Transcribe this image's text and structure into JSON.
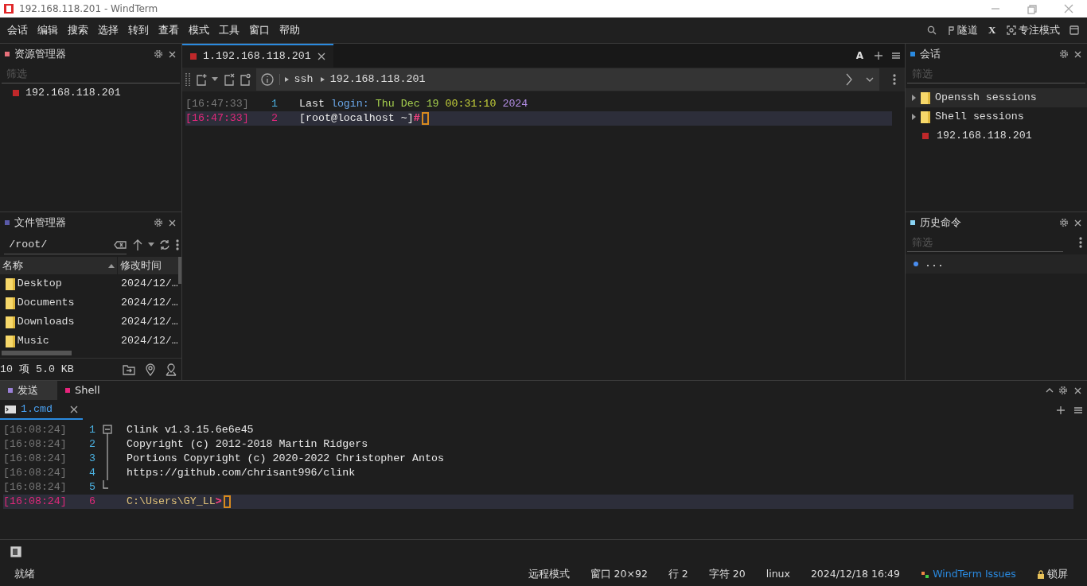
{
  "window": {
    "title": "192.168.118.201 - WindTerm"
  },
  "menu": [
    "会话",
    "编辑",
    "搜索",
    "选择",
    "转到",
    "查看",
    "模式",
    "工具",
    "窗口",
    "帮助"
  ],
  "toolbar": {
    "tunnel": "隧道",
    "x_label": "X",
    "focus": "专注模式"
  },
  "explorer": {
    "title": "资源管理器",
    "placeholder": "筛选",
    "items": [
      {
        "label": "192.168.118.201"
      }
    ]
  },
  "file_manager": {
    "title": "文件管理器",
    "path": "/root/",
    "columns": [
      "名称",
      "修改时间"
    ],
    "rows": [
      {
        "name": "Desktop",
        "modified": "2024/12/…"
      },
      {
        "name": "Documents",
        "modified": "2024/12/…"
      },
      {
        "name": "Downloads",
        "modified": "2024/12/…"
      },
      {
        "name": "Music",
        "modified": "2024/12/…"
      }
    ],
    "summary": "10 项 5.0 KB"
  },
  "terminal": {
    "tabs": [
      {
        "label": "1.192.168.118.201",
        "selected": true
      }
    ],
    "font_button": "A",
    "breadcrumb": [
      "ssh",
      "192.168.118.201"
    ],
    "lines": [
      {
        "time": "[16:47:33]",
        "number": "1",
        "selected": false,
        "segments": [
          {
            "text": "Last",
            "color": "#e8e8e8"
          },
          {
            "text": "login:",
            "color": "#6aa6e8"
          },
          {
            "text": "Thu Dec",
            "color": "#a6d04e"
          },
          {
            "text": "19",
            "color": "#a6d04e"
          },
          {
            "text": "00:31:10",
            "color": "#c6d23a"
          },
          {
            "text": "2024",
            "color": "#b48ee6"
          }
        ]
      },
      {
        "time": "[16:47:33]",
        "number": "2",
        "selected": true,
        "segments": [
          {
            "text": "[root@localhost ~]",
            "color": "#e8e8e8"
          },
          {
            "text": "#",
            "color": "#e8407c",
            "tight": true
          }
        ]
      }
    ]
  },
  "sessions": {
    "title": "会话",
    "placeholder": "筛选",
    "tree": [
      {
        "label": "Openssh sessions",
        "kind": "folder",
        "selected": true
      },
      {
        "label": "Shell sessions",
        "kind": "folder",
        "selected": false
      },
      {
        "label": "192.168.118.201",
        "kind": "session",
        "selected": false
      }
    ]
  },
  "history": {
    "title": "历史命令",
    "placeholder": "筛选",
    "items": [
      "..."
    ]
  },
  "bottom": {
    "tabs": [
      {
        "label": "发送",
        "selected": true,
        "color": "#9a80d8"
      },
      {
        "label": "Shell",
        "selected": false,
        "color": "#e8247c"
      }
    ],
    "sub_tabs": [
      {
        "label": "1.cmd",
        "selected": true
      }
    ],
    "lines": [
      {
        "time": "[16:08:24]",
        "number": "1",
        "selected": false,
        "segments": [
          {
            "text": "Clink v1.3.15.6e6e45",
            "color": "#e8e8e8"
          }
        ]
      },
      {
        "time": "[16:08:24]",
        "number": "2",
        "selected": false,
        "segments": [
          {
            "text": "Copyright (c) 2012-2018 Martin Ridgers",
            "color": "#e8e8e8"
          }
        ]
      },
      {
        "time": "[16:08:24]",
        "number": "3",
        "selected": false,
        "segments": [
          {
            "text": "Portions Copyright (c) 2020-2022 Christopher Antos",
            "color": "#e8e8e8"
          }
        ]
      },
      {
        "time": "[16:08:24]",
        "number": "4",
        "selected": false,
        "segments": [
          {
            "text": "https://github.com/chrisant996/clink",
            "color": "#e8e8e8"
          }
        ]
      },
      {
        "time": "[16:08:24]",
        "number": "5",
        "selected": false
      },
      {
        "time": "[16:08:24]",
        "number": "6",
        "selected": true,
        "segments": [
          {
            "text": "C:\\Users\\GY_LL",
            "color": "#e2c37a"
          },
          {
            "text": ">",
            "color": "#e8407c",
            "tight": true
          }
        ]
      }
    ]
  },
  "status_bar": {
    "ready": "就绪",
    "items": [
      "远程模式",
      "窗口 20×92",
      "行 2",
      "字符 20",
      "linux",
      "2024/12/18 16:49"
    ],
    "issues": "WindTerm Issues",
    "lock": "锁屏"
  }
}
